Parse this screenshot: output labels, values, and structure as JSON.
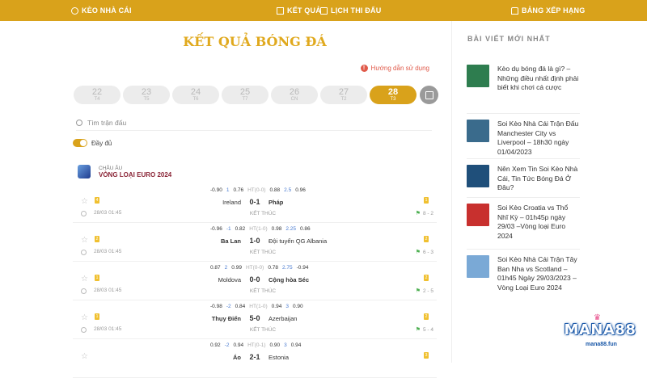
{
  "topbar": {
    "bookmakers": "KÈO NHÀ CÁI",
    "results": "KẾT QUẢ",
    "schedule": "LỊCH THI ĐẤU",
    "rankings": "BẢNG XẾP HẠNG"
  },
  "page_title": "KẾT QUẢ BÓNG ĐÁ",
  "guide_link": "Hướng dẫn sử dụng",
  "dates": [
    {
      "day": "22",
      "weekday": "T4"
    },
    {
      "day": "23",
      "weekday": "T5"
    },
    {
      "day": "24",
      "weekday": "T6"
    },
    {
      "day": "25",
      "weekday": "T7"
    },
    {
      "day": "26",
      "weekday": "CN"
    },
    {
      "day": "27",
      "weekday": "T2"
    },
    {
      "day": "28",
      "weekday": "T3"
    }
  ],
  "active_date_index": 6,
  "search": {
    "placeholder": "Tìm trận đấu"
  },
  "toggle_label": "Đầy đủ",
  "league": {
    "region": "CHÂU ÂU",
    "name": "VÒNG LOẠI EURO 2024"
  },
  "matches": [
    {
      "o1": "-0.90",
      "o2": "1",
      "o3": "0.76",
      "ht": "HT(0-0)",
      "o4": "0.88",
      "o5": "2.5",
      "o6": "0.96",
      "home": "Ireland",
      "score": "0-1",
      "away": "Pháp",
      "winner": "away",
      "home_card": "4",
      "away_card": "1",
      "time": "28/03 01:45",
      "status": "KẾT THÚC",
      "corners": "8 - 2"
    },
    {
      "o1": "-0.96",
      "o2": "-1",
      "o3": "0.82",
      "ht": "HT(1-0)",
      "o4": "0.98",
      "o5": "2.25",
      "o6": "0.86",
      "home": "Ba Lan",
      "score": "1-0",
      "away": "Đội tuyển QG Albania",
      "winner": "home",
      "home_card": "2",
      "away_card": "2",
      "time": "28/03 01:45",
      "status": "KẾT THÚC",
      "corners": "6 - 3"
    },
    {
      "o1": "0.87",
      "o2": "2",
      "o3": "0.99",
      "ht": "HT(0-0)",
      "o4": "0.78",
      "o5": "2.75",
      "o6": "-0.94",
      "home": "Moldova",
      "score": "0-0",
      "away": "Cộng hòa Séc",
      "winner": "away",
      "home_card": "1",
      "away_card": "2",
      "time": "28/03 01:45",
      "status": "KẾT THÚC",
      "corners": "2 - 5"
    },
    {
      "o1": "-0.98",
      "o2": "-2",
      "o3": "0.84",
      "ht": "HT(1-0)",
      "o4": "0.94",
      "o5": "3",
      "o6": "0.90",
      "home": "Thụy Điển",
      "score": "5-0",
      "away": "Azerbaijan",
      "winner": "home",
      "home_card": "1",
      "away_card": "2",
      "time": "28/03 01:45",
      "status": "KẾT THÚC",
      "corners": "5 - 4"
    },
    {
      "o1": "0.92",
      "o2": "-2",
      "o3": "0.94",
      "ht": "HT(0-1)",
      "o4": "0.90",
      "o5": "3",
      "o6": "0.94",
      "home": "Áo",
      "score": "2-1",
      "away": "Estonia",
      "winner": "home",
      "home_card": "",
      "away_card": "3",
      "time": "",
      "status": "",
      "corners": ""
    }
  ],
  "sidebar": {
    "title": "BÀI VIẾT MỚI NHẤT",
    "posts": [
      {
        "text": "Kèo dụ bóng đá là gì? – Những điều nhất định phải biết khi chơi cá cược",
        "thumb_color": "#2e7d4f"
      },
      {
        "text": "Soi Kèo Nhà Cái Trận Đấu Manchester City vs Liverpool – 18h30 ngày 01/04/2023",
        "thumb_color": "#3a6b8c"
      },
      {
        "text": "Nên Xem Tin Soi Kèo Nhà Cái, Tin Tức Bóng Đá Ở Đâu?",
        "thumb_color": "#1f4f7a"
      },
      {
        "text": "Soi Kèo Croatia vs Thổ Nhĩ Kỳ – 01h45p ngày 29/03 –Vòng loại Euro 2024",
        "thumb_color": "#c8302e"
      },
      {
        "text": "Soi Kèo Nhà Cái Trận Tây Ban Nha vs Scotland – 01h45 Ngày 29/03/2023 – Vòng Loại Euro 2024",
        "thumb_color": "#7aa9d6"
      }
    ]
  },
  "brand": {
    "logo": "MANA88",
    "url": "mana88.fun"
  },
  "colors": {
    "accent": "#d9a21b",
    "title": "#e0a91e",
    "league": "#8a2436",
    "odds_blue": "#4a7bd0",
    "guide_red": "#e05a4a"
  }
}
